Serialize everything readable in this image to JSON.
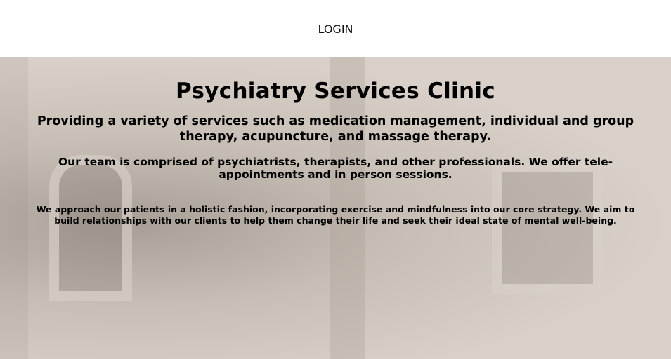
{
  "header": {
    "login_label": "LOGIN"
  },
  "hero": {
    "title": "Psychiatry Services Clinic",
    "services": "Providing a variety of services such as medication management, individual and group therapy, acupuncture, and massage therapy.",
    "team": "Our team is comprised of psychiatrists, therapists, and other professionals. We offer tele-appointments and in person sessions.",
    "approach": "We approach our patients in a holistic fashion, incorporating exercise and mindfulness into our core strategy. We aim to build relationships with our clients to help them change their life and seek their ideal state of mental well-being."
  },
  "colors": {
    "header_bg": "#ffffff",
    "hero_bg": "#cfc6bd",
    "text": "#000000"
  }
}
